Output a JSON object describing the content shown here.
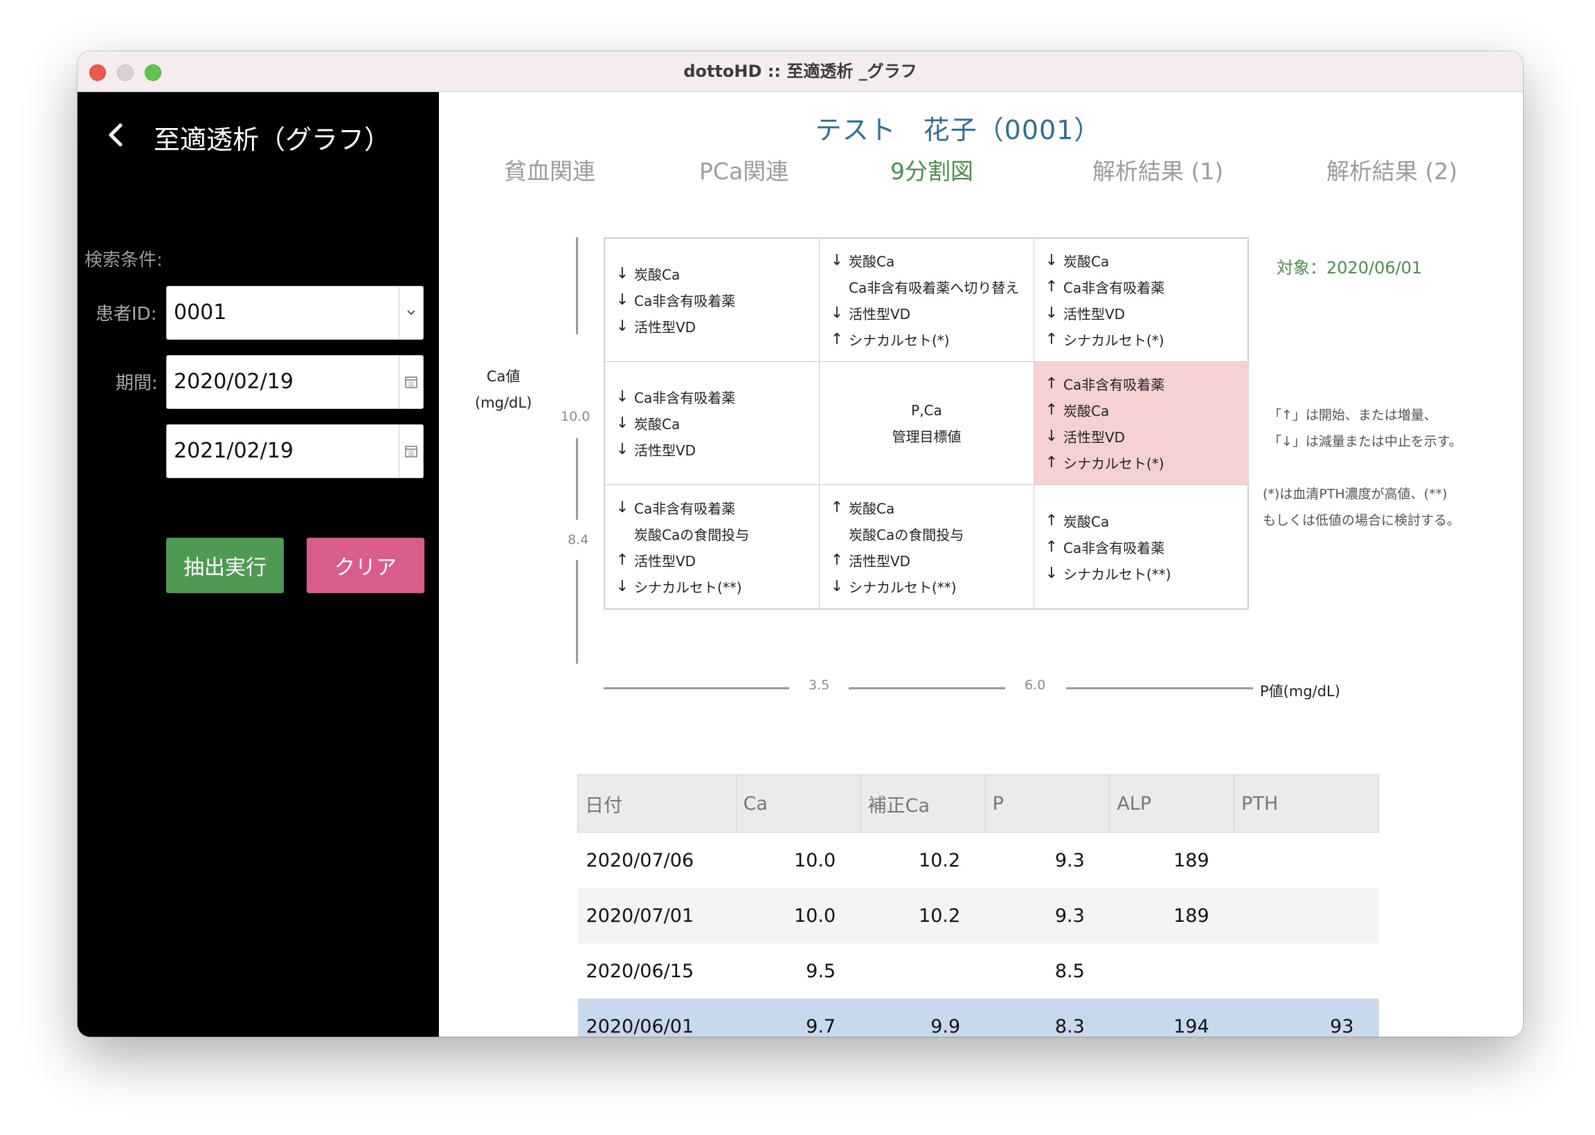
{
  "window": {
    "title": "dottoHD :: 至適透析 _グラフ"
  },
  "sidebar": {
    "title": "至適透析（グラフ）",
    "search_label": "検索条件:",
    "patient_id_label": "患者ID:",
    "patient_id_value": "0001",
    "period_label": "期間:",
    "period_start": "2020/02/19",
    "period_end": "2021/02/19",
    "extract_button": "抽出実行",
    "clear_button": "クリア"
  },
  "main": {
    "patient_name": "テスト　花子（0001）",
    "tabs": [
      {
        "label": "貧血関連",
        "active": false
      },
      {
        "label": "PCa関連",
        "active": false
      },
      {
        "label": "9分割図",
        "active": true
      },
      {
        "label": "解析結果 (1)",
        "active": false
      },
      {
        "label": "解析結果 (2)",
        "active": false
      }
    ],
    "target_date": "対象：2020/06/01",
    "notes": [
      "「↑」は開始、または増量、",
      "「↓」は減量または中止を示す。",
      "(*)は血清PTH濃度が高値、(**)",
      "もしくは低値の場合に検討する。"
    ]
  },
  "chart_data": {
    "type": "table",
    "title": "",
    "y_axis": {
      "label_line1": "Ca値",
      "label_line2": "(mg/dL)",
      "ticks": [
        "10.0",
        "8.4"
      ]
    },
    "x_axis": {
      "label": "P値(mg/dL)",
      "ticks": [
        "3.5",
        "6.0"
      ]
    },
    "highlighted_cell": "row1-col3",
    "cells": {
      "r1c1": [
        {
          "arrow": "↓",
          "text": "炭酸Ca"
        },
        {
          "arrow": "↓",
          "text": "Ca非含有吸着薬"
        },
        {
          "arrow": "↓",
          "text": "活性型VD"
        }
      ],
      "r1c2": [
        {
          "arrow": "↓",
          "text": "炭酸Ca"
        },
        {
          "arrow": "",
          "text": "Ca非含有吸着薬へ切り替え"
        },
        {
          "arrow": "↓",
          "text": "活性型VD"
        },
        {
          "arrow": "↑",
          "text": "シナカルセト(*)"
        }
      ],
      "r1c3": [
        {
          "arrow": "↓",
          "text": "炭酸Ca"
        },
        {
          "arrow": "↑",
          "text": "Ca非含有吸着薬"
        },
        {
          "arrow": "↓",
          "text": "活性型VD"
        },
        {
          "arrow": "↑",
          "text": "シナカルセト(*)"
        }
      ],
      "r2c1": [
        {
          "arrow": "↓",
          "text": "Ca非含有吸着薬"
        },
        {
          "arrow": "↓",
          "text": "炭酸Ca"
        },
        {
          "arrow": "↓",
          "text": "活性型VD"
        }
      ],
      "r2c2_line1": "P,Ca",
      "r2c2_line2": "管理目標値",
      "r2c3": [
        {
          "arrow": "↑",
          "text": "Ca非含有吸着薬"
        },
        {
          "arrow": "↑",
          "text": "炭酸Ca"
        },
        {
          "arrow": "↓",
          "text": "活性型VD"
        },
        {
          "arrow": "↑",
          "text": "シナカルセト(*)"
        }
      ],
      "r3c1": [
        {
          "arrow": "↓",
          "text": "Ca非含有吸着薬"
        },
        {
          "arrow": "",
          "text": "炭酸Caの食間投与"
        },
        {
          "arrow": "↑",
          "text": "活性型VD"
        },
        {
          "arrow": "↓",
          "text": "シナカルセト(**)"
        }
      ],
      "r3c2": [
        {
          "arrow": "↑",
          "text": "炭酸Ca"
        },
        {
          "arrow": "",
          "text": "炭酸Caの食間投与"
        },
        {
          "arrow": "↑",
          "text": "活性型VD"
        },
        {
          "arrow": "↓",
          "text": "シナカルセト(**)"
        }
      ],
      "r3c3": [
        {
          "arrow": "↑",
          "text": "炭酸Ca"
        },
        {
          "arrow": "↑",
          "text": "Ca非含有吸着薬"
        },
        {
          "arrow": "↓",
          "text": "シナカルセト(**)"
        }
      ]
    }
  },
  "table": {
    "headers": [
      "日付",
      "Ca",
      "補正Ca",
      "P",
      "ALP",
      "PTH"
    ],
    "rows": [
      [
        "2020/07/06",
        "10.0",
        "10.2",
        "9.3",
        "189",
        ""
      ],
      [
        "2020/07/01",
        "10.0",
        "10.2",
        "9.3",
        "189",
        ""
      ],
      [
        "2020/06/15",
        "9.5",
        "",
        "8.5",
        "",
        ""
      ],
      [
        "2020/06/01",
        "9.7",
        "9.9",
        "8.3",
        "194",
        "93"
      ]
    ]
  }
}
